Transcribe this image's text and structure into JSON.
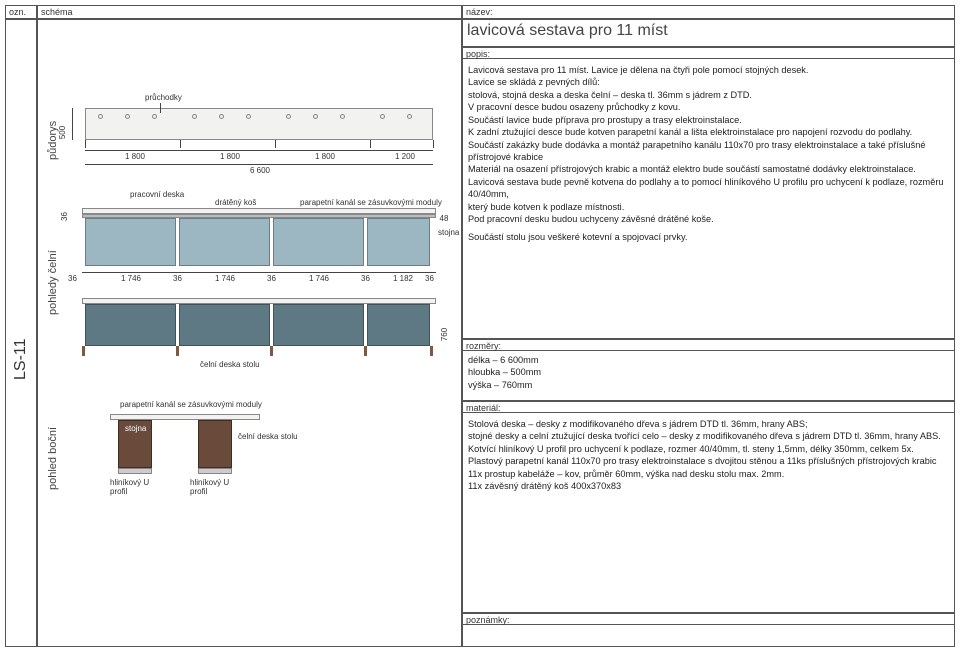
{
  "headers": {
    "ozn": "ozn.",
    "schema": "schéma",
    "nazev": "název:",
    "popis": "popis:",
    "rozmery": "rozměry:",
    "material": "materiál:",
    "poznamky": "poznámky:"
  },
  "code": "LS-11",
  "title": "lavicová sestava pro 11 míst",
  "views": {
    "pudorys": "půdorys",
    "pohledy_celni": "pohledy čelní",
    "pohled_bocni": "pohled boční"
  },
  "annotations": {
    "pruchodky": "průchodky",
    "pracovni_deska": "pracovní deska",
    "drateny_kos": "drátěný koš",
    "parapet_kanal": "parapetní kanál se zásuvkovými moduly",
    "stojna": "stojna",
    "celni_deska": "čelní deska stolu",
    "hlinik_u": "hliníkový U profil"
  },
  "dims_plan": {
    "b1": "1 800",
    "b2": "1 800",
    "b3": "1 800",
    "b4": "1 200",
    "total": "6 600",
    "depth": "500"
  },
  "dims_front": {
    "top_h": "36",
    "s1": "1 746",
    "s2": "1 746",
    "s3": "1 746",
    "s4": "1 182",
    "g": "36",
    "g_end": "36",
    "side_h": "760",
    "leg_w": "48"
  },
  "description": [
    "Lavicová sestava pro 11 míst. Lavice je dělena na čtyři pole pomocí stojných desek.",
    "Lavice se skládá z pevných dílů:",
    "stolová, stojná deska a deska čelní – deska tl. 36mm s jádrem z DTD.",
    "V pracovní desce budou osazeny průchodky z kovu.",
    "Součástí lavice bude příprava pro prostupy a trasy elektroinstalace.",
    "K zadní ztužující desce bude kotven parapetní kanál a lišta elektroinstalace pro napojení rozvodu do podlahy.",
    "Součástí zakázky bude dodávka a montáž parapetního kanálu 110x70 pro trasy elektroinstalace a také příslušné přístrojové krabice",
    "Materiál na osazení přístrojových krabic a montáž elektro bude součástí samostatné dodávky elektroinstalace.",
    "Lavicová sestava bude pevně kotvena do podlahy a to pomocí hliníkového U profilu pro uchycení k podlaze, rozměru 40/40mm,",
    "který bude kotven k podlaze místnosti.",
    "Pod pracovní desku budou uchyceny závěsné drátěné koše.",
    "",
    "Součástí stolu jsou veškeré kotevní a spojovací prvky."
  ],
  "rozmery": [
    "délka – 6 600mm",
    "hloubka – 500mm",
    "výška – 760mm"
  ],
  "material": [
    "Stolová deska  – desky z modifikovaného dřeva s jádrem DTD tl. 36mm, hrany ABS;",
    "stojné desky a celní ztužující deska tvořící celo – desky z modifikovaného dřeva s jádrem DTD tl. 36mm, hrany ABS.",
    "Kotvící hliníkový U profil pro uchycení k podlaze, rozmer 40/40mm, tl. steny 1,5mm, délky 350mm, celkem 5x.",
    "Plastový parapetní kanál 110x70 pro trasy elektroinstalace s dvojitou stěnou a 11ks příslušných přístrojových krabic",
    "11x prostup kabeláže – kov, průměr 60mm, výška nad desku stolu max. 2mm.",
    "11x závěsný drátěný koš 400x370x83"
  ]
}
